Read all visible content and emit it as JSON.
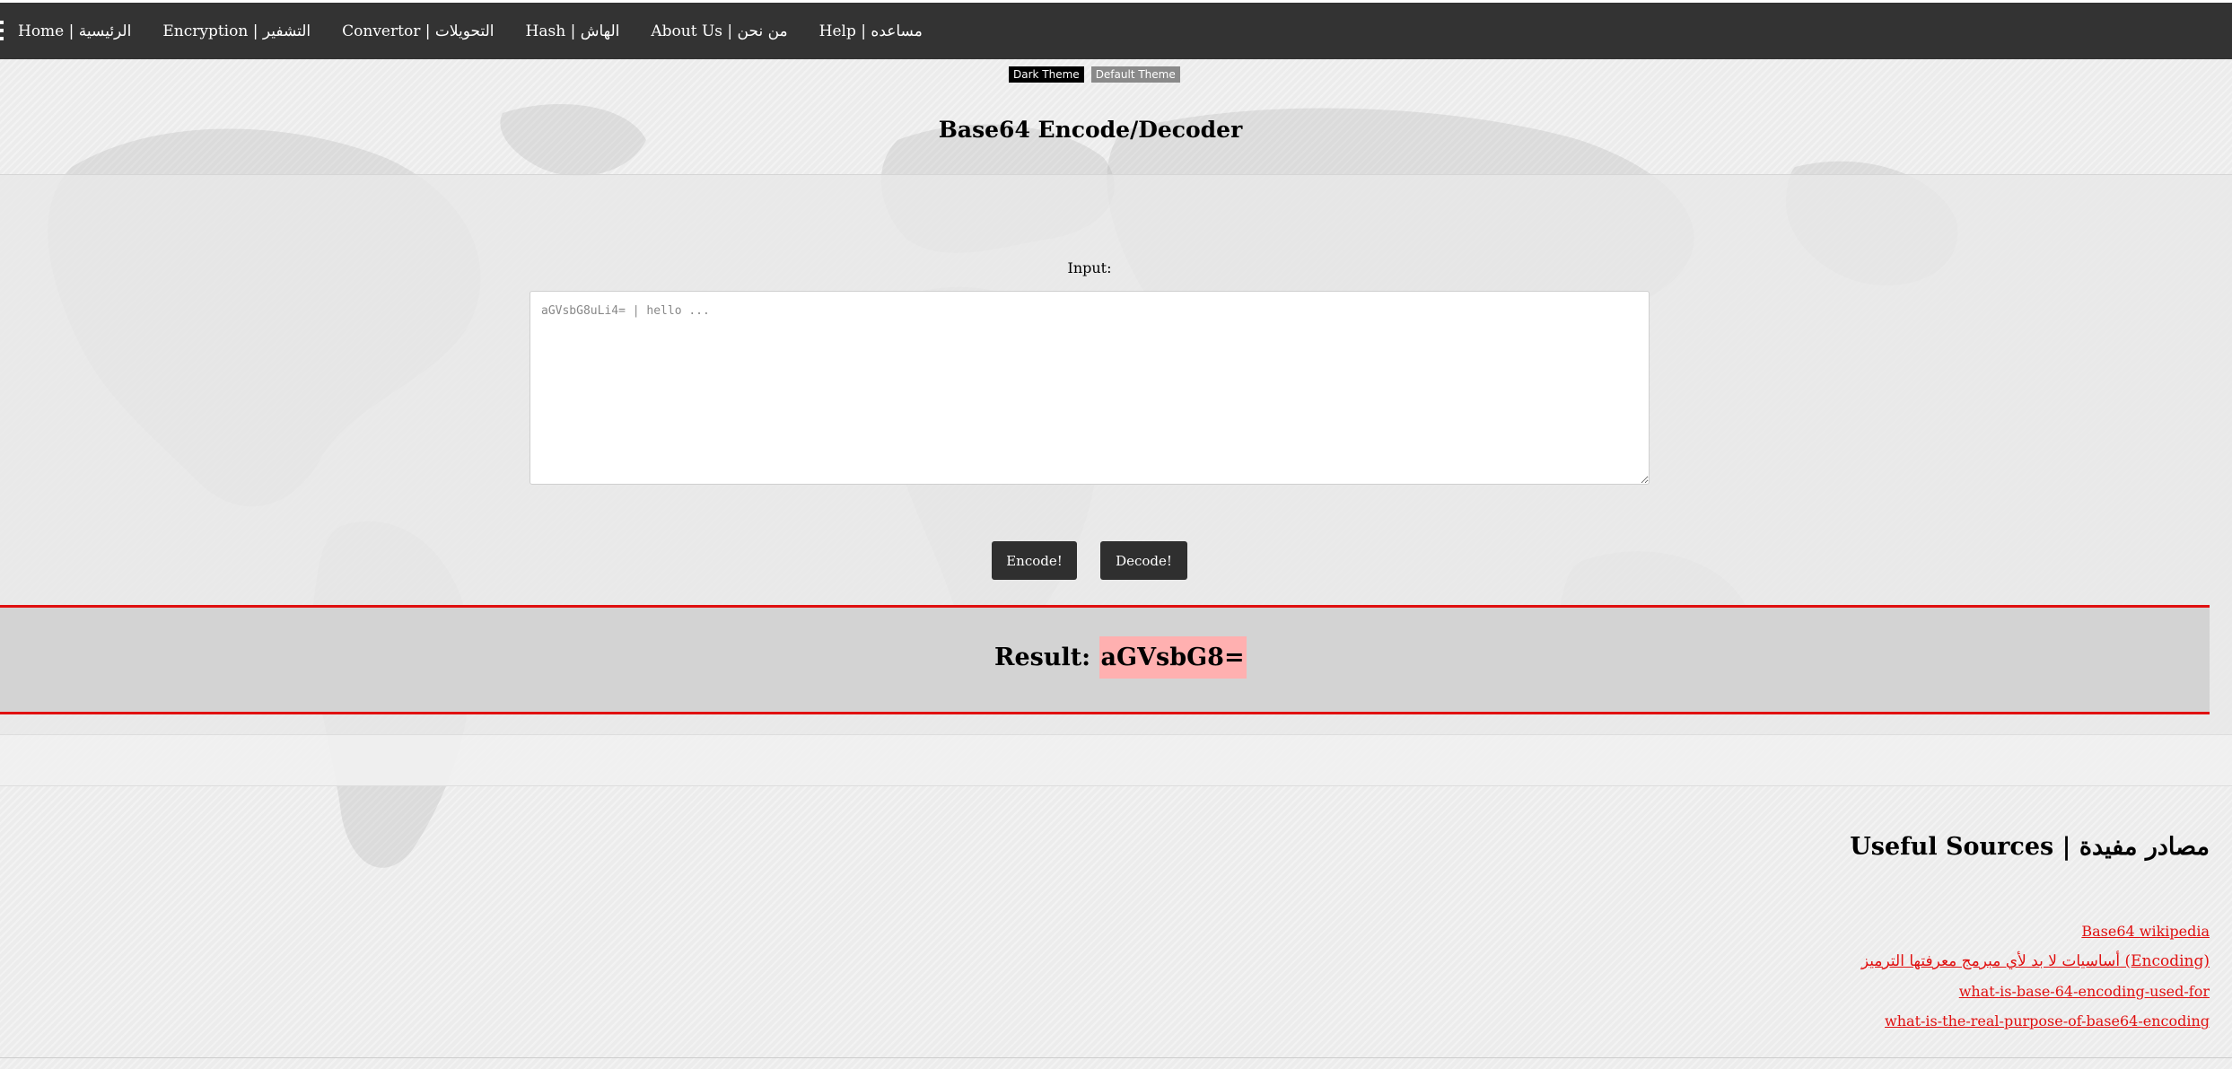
{
  "nav": {
    "items": [
      {
        "label": "Home | الرئيسية"
      },
      {
        "label": "Encryption | التشفير"
      },
      {
        "label": "Convertor | التحويلات"
      },
      {
        "label": "Hash | الهاش"
      },
      {
        "label": "About Us | من نحن"
      },
      {
        "label": "Help | مساعده"
      }
    ]
  },
  "theme": {
    "dark_label": "Dark Theme",
    "default_label": "Default Theme"
  },
  "page": {
    "title": "Base64 Encode/Decoder"
  },
  "form": {
    "input_label": "Input:",
    "input_placeholder": "aGVsbG8uLi4= | hello ...",
    "input_value": "",
    "encode_label": "Encode!",
    "decode_label": "Decode!"
  },
  "result": {
    "label": "Result: ",
    "value": "aGVsbG8="
  },
  "sources": {
    "heading": "Useful Sources | مصادر مفيدة",
    "links": [
      {
        "label": "Base64 wikipedia"
      },
      {
        "label": "أساسيات لا بد لأي مبرمج معرفتها الترميز (Encoding)"
      },
      {
        "label": "what-is-base-64-encoding-used-for"
      },
      {
        "label": "what-is-the-real-purpose-of-base64-encoding"
      }
    ]
  },
  "colors": {
    "topbar": "#333333",
    "accent_red": "#e01010",
    "result_highlight": "#ffb0b0",
    "button": "#2f2f2f"
  }
}
